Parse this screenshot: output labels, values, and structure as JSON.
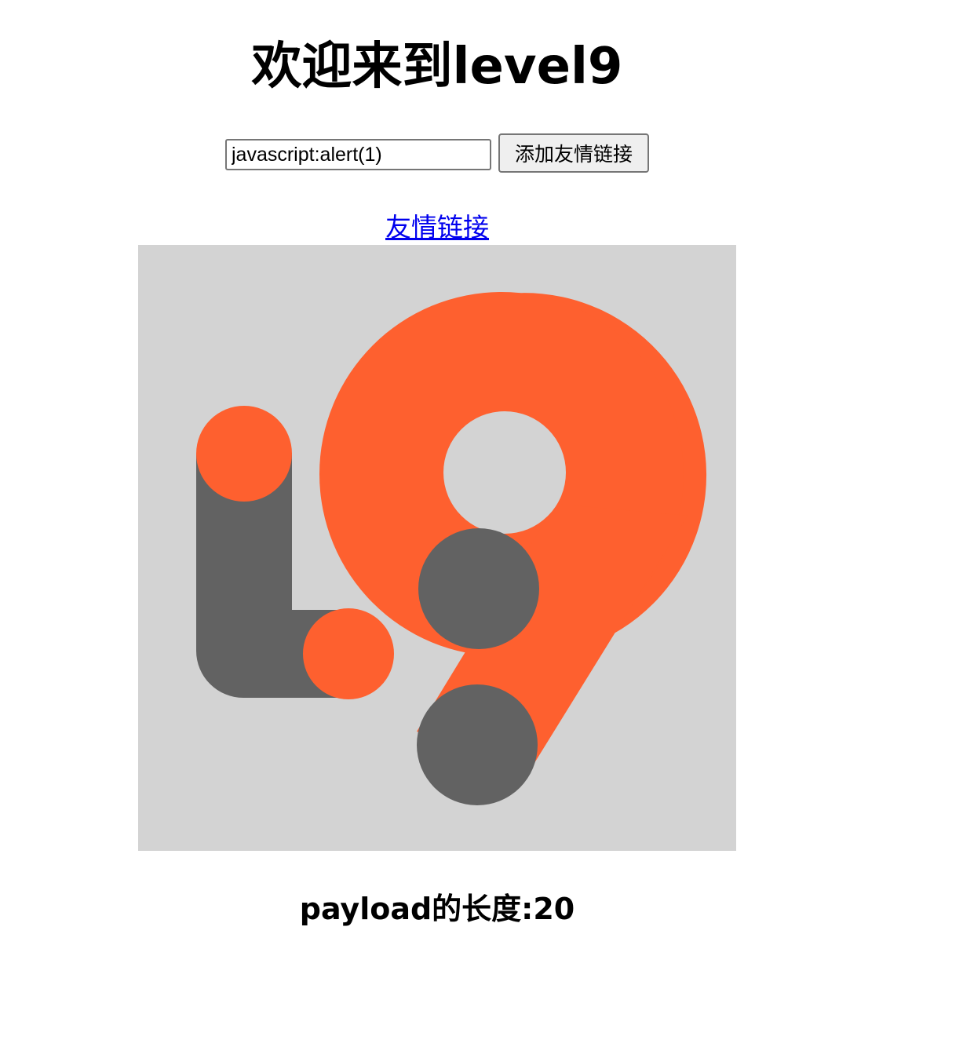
{
  "page": {
    "title": "欢迎来到level9"
  },
  "form": {
    "keyword_value": "javascript:alert(1)",
    "submit_label": "添加友情链接"
  },
  "friend_link": {
    "label": "友情链接"
  },
  "logo": {
    "icon": "level9-logo",
    "colors": {
      "background": "#d3d3d3",
      "orange": "#fe602f",
      "gray": "#626262"
    }
  },
  "footer": {
    "payload_length_text": "payload的长度:20"
  }
}
